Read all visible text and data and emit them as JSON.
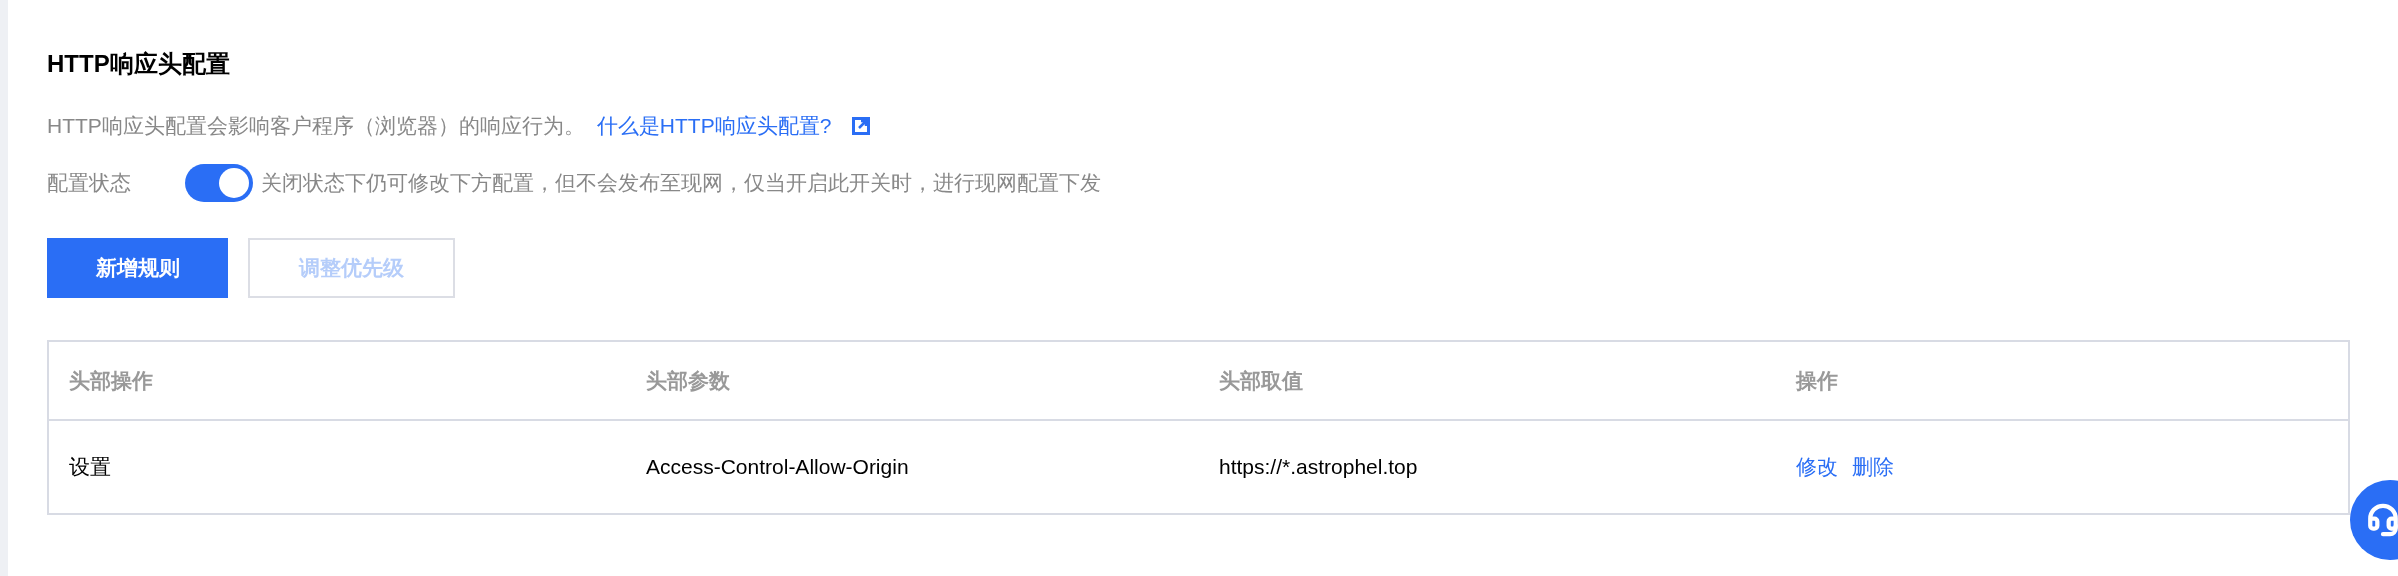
{
  "section": {
    "title": "HTTP响应头配置",
    "description": "HTTP响应头配置会影响客户程序（浏览器）的响应行为。",
    "help_link": "什么是HTTP响应头配置?"
  },
  "config_status": {
    "label": "配置状态",
    "on": true,
    "hint": "关闭状态下仍可修改下方配置，但不会发布至现网，仅当开启此开关时，进行现网配置下发"
  },
  "buttons": [
    {
      "label": "新增规则",
      "kind": "primary",
      "disabled": false
    },
    {
      "label": "调整优先级",
      "kind": "secondary",
      "disabled": true
    }
  ],
  "table": {
    "columns": [
      "头部操作",
      "头部参数",
      "头部取值",
      "操作"
    ],
    "rows": [
      {
        "cells": [
          "设置",
          "Access-Control-Allow-Origin",
          "https://*.astrophel.top"
        ],
        "actions": [
          "修改",
          "删除"
        ]
      }
    ]
  }
}
